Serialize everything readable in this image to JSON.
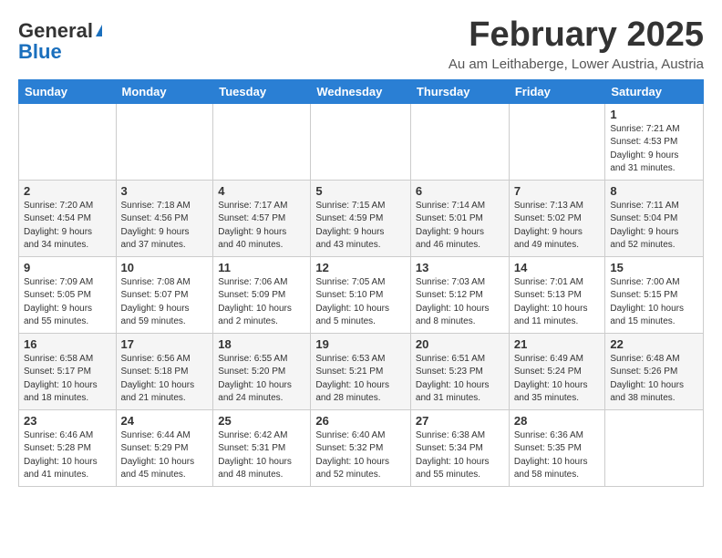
{
  "header": {
    "logo_general": "General",
    "logo_blue": "Blue",
    "month_title": "February 2025",
    "location": "Au am Leithaberge, Lower Austria, Austria"
  },
  "days_of_week": [
    "Sunday",
    "Monday",
    "Tuesday",
    "Wednesday",
    "Thursday",
    "Friday",
    "Saturday"
  ],
  "weeks": [
    [
      {
        "day": "",
        "info": ""
      },
      {
        "day": "",
        "info": ""
      },
      {
        "day": "",
        "info": ""
      },
      {
        "day": "",
        "info": ""
      },
      {
        "day": "",
        "info": ""
      },
      {
        "day": "",
        "info": ""
      },
      {
        "day": "1",
        "info": "Sunrise: 7:21 AM\nSunset: 4:53 PM\nDaylight: 9 hours\nand 31 minutes."
      }
    ],
    [
      {
        "day": "2",
        "info": "Sunrise: 7:20 AM\nSunset: 4:54 PM\nDaylight: 9 hours\nand 34 minutes."
      },
      {
        "day": "3",
        "info": "Sunrise: 7:18 AM\nSunset: 4:56 PM\nDaylight: 9 hours\nand 37 minutes."
      },
      {
        "day": "4",
        "info": "Sunrise: 7:17 AM\nSunset: 4:57 PM\nDaylight: 9 hours\nand 40 minutes."
      },
      {
        "day": "5",
        "info": "Sunrise: 7:15 AM\nSunset: 4:59 PM\nDaylight: 9 hours\nand 43 minutes."
      },
      {
        "day": "6",
        "info": "Sunrise: 7:14 AM\nSunset: 5:01 PM\nDaylight: 9 hours\nand 46 minutes."
      },
      {
        "day": "7",
        "info": "Sunrise: 7:13 AM\nSunset: 5:02 PM\nDaylight: 9 hours\nand 49 minutes."
      },
      {
        "day": "8",
        "info": "Sunrise: 7:11 AM\nSunset: 5:04 PM\nDaylight: 9 hours\nand 52 minutes."
      }
    ],
    [
      {
        "day": "9",
        "info": "Sunrise: 7:09 AM\nSunset: 5:05 PM\nDaylight: 9 hours\nand 55 minutes."
      },
      {
        "day": "10",
        "info": "Sunrise: 7:08 AM\nSunset: 5:07 PM\nDaylight: 9 hours\nand 59 minutes."
      },
      {
        "day": "11",
        "info": "Sunrise: 7:06 AM\nSunset: 5:09 PM\nDaylight: 10 hours\nand 2 minutes."
      },
      {
        "day": "12",
        "info": "Sunrise: 7:05 AM\nSunset: 5:10 PM\nDaylight: 10 hours\nand 5 minutes."
      },
      {
        "day": "13",
        "info": "Sunrise: 7:03 AM\nSunset: 5:12 PM\nDaylight: 10 hours\nand 8 minutes."
      },
      {
        "day": "14",
        "info": "Sunrise: 7:01 AM\nSunset: 5:13 PM\nDaylight: 10 hours\nand 11 minutes."
      },
      {
        "day": "15",
        "info": "Sunrise: 7:00 AM\nSunset: 5:15 PM\nDaylight: 10 hours\nand 15 minutes."
      }
    ],
    [
      {
        "day": "16",
        "info": "Sunrise: 6:58 AM\nSunset: 5:17 PM\nDaylight: 10 hours\nand 18 minutes."
      },
      {
        "day": "17",
        "info": "Sunrise: 6:56 AM\nSunset: 5:18 PM\nDaylight: 10 hours\nand 21 minutes."
      },
      {
        "day": "18",
        "info": "Sunrise: 6:55 AM\nSunset: 5:20 PM\nDaylight: 10 hours\nand 24 minutes."
      },
      {
        "day": "19",
        "info": "Sunrise: 6:53 AM\nSunset: 5:21 PM\nDaylight: 10 hours\nand 28 minutes."
      },
      {
        "day": "20",
        "info": "Sunrise: 6:51 AM\nSunset: 5:23 PM\nDaylight: 10 hours\nand 31 minutes."
      },
      {
        "day": "21",
        "info": "Sunrise: 6:49 AM\nSunset: 5:24 PM\nDaylight: 10 hours\nand 35 minutes."
      },
      {
        "day": "22",
        "info": "Sunrise: 6:48 AM\nSunset: 5:26 PM\nDaylight: 10 hours\nand 38 minutes."
      }
    ],
    [
      {
        "day": "23",
        "info": "Sunrise: 6:46 AM\nSunset: 5:28 PM\nDaylight: 10 hours\nand 41 minutes."
      },
      {
        "day": "24",
        "info": "Sunrise: 6:44 AM\nSunset: 5:29 PM\nDaylight: 10 hours\nand 45 minutes."
      },
      {
        "day": "25",
        "info": "Sunrise: 6:42 AM\nSunset: 5:31 PM\nDaylight: 10 hours\nand 48 minutes."
      },
      {
        "day": "26",
        "info": "Sunrise: 6:40 AM\nSunset: 5:32 PM\nDaylight: 10 hours\nand 52 minutes."
      },
      {
        "day": "27",
        "info": "Sunrise: 6:38 AM\nSunset: 5:34 PM\nDaylight: 10 hours\nand 55 minutes."
      },
      {
        "day": "28",
        "info": "Sunrise: 6:36 AM\nSunset: 5:35 PM\nDaylight: 10 hours\nand 58 minutes."
      },
      {
        "day": "",
        "info": ""
      }
    ]
  ]
}
